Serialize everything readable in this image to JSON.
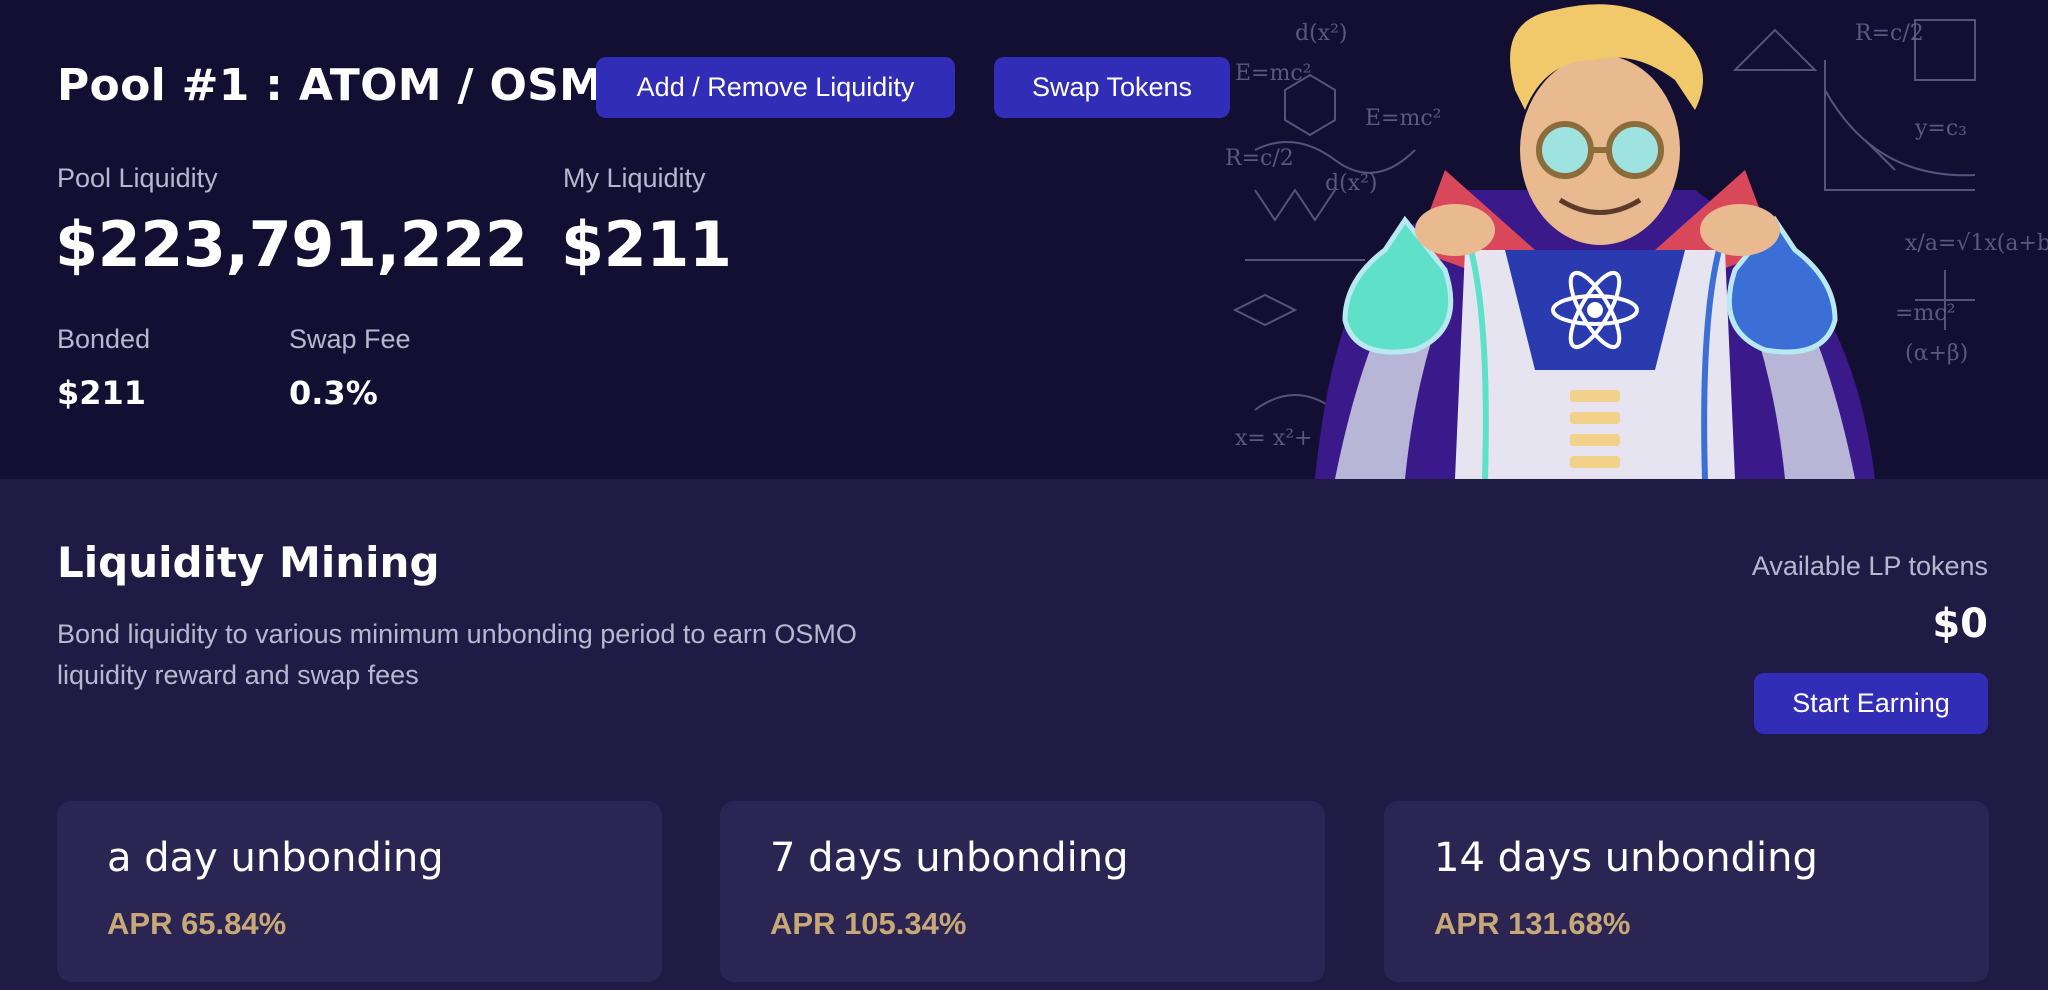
{
  "pool": {
    "title": "Pool #1 : ATOM / OSMO",
    "add_remove_label": "Add / Remove Liquidity",
    "swap_label": "Swap Tokens",
    "pool_liquidity_label": "Pool Liquidity",
    "pool_liquidity_value": "$223,791,222",
    "my_liquidity_label": "My Liquidity",
    "my_liquidity_value": "$211",
    "bonded_label": "Bonded",
    "bonded_value": "$211",
    "swap_fee_label": "Swap Fee",
    "swap_fee_value": "0.3%"
  },
  "mining": {
    "title": "Liquidity Mining",
    "description": "Bond liquidity to various minimum unbonding period to earn OSMO liquidity reward and swap fees",
    "lp_label": "Available LP tokens",
    "lp_value": "$0",
    "start_label": "Start Earning",
    "cards": [
      {
        "title": "a day unbonding",
        "apr": "APR 65.84%"
      },
      {
        "title": "7 days unbonding",
        "apr": "APR 105.34%"
      },
      {
        "title": "14 days unbonding",
        "apr": "APR 131.68%"
      }
    ]
  },
  "colors": {
    "hero_bg": "#130f33",
    "page_bg": "#201b45",
    "card_bg": "#2b2554",
    "accent_button": "#322db7",
    "apr_gold": "#c8a877",
    "muted_text": "#b9b7cf"
  },
  "illustration": {
    "icon": "scientist-mascot-icon",
    "emblem": "atom-icon"
  }
}
